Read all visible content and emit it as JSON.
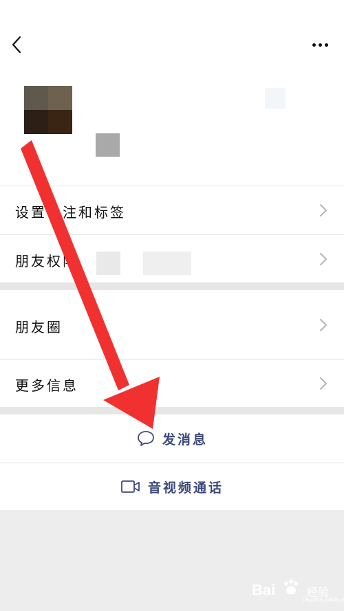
{
  "header": {
    "back_icon": "chevron-left-icon",
    "more_icon": "more-dots-icon"
  },
  "rows": [
    {
      "label": "设置备注和标签",
      "icon": "chevron-right-icon"
    },
    {
      "label": "朋友权限",
      "icon": "chevron-right-icon"
    },
    {
      "label": "朋友圈",
      "icon": "chevron-right-icon"
    },
    {
      "label": "更多信息",
      "icon": "chevron-right-icon"
    }
  ],
  "actions": {
    "send_message": {
      "label": "发消息",
      "icon": "chat-bubble-icon"
    },
    "video_call": {
      "label": "音视频通话",
      "icon": "video-camera-icon"
    }
  },
  "overlay": {
    "arrow_color": "#f0312f",
    "icon": "red-arrow-annotation"
  },
  "watermark": {
    "text": "Bai",
    "sub": "经验",
    "url": "jingyan.baidu.com"
  },
  "colors": {
    "accent": "#3c4a7a",
    "background": "#ededed",
    "arrow": "#f0312f"
  }
}
